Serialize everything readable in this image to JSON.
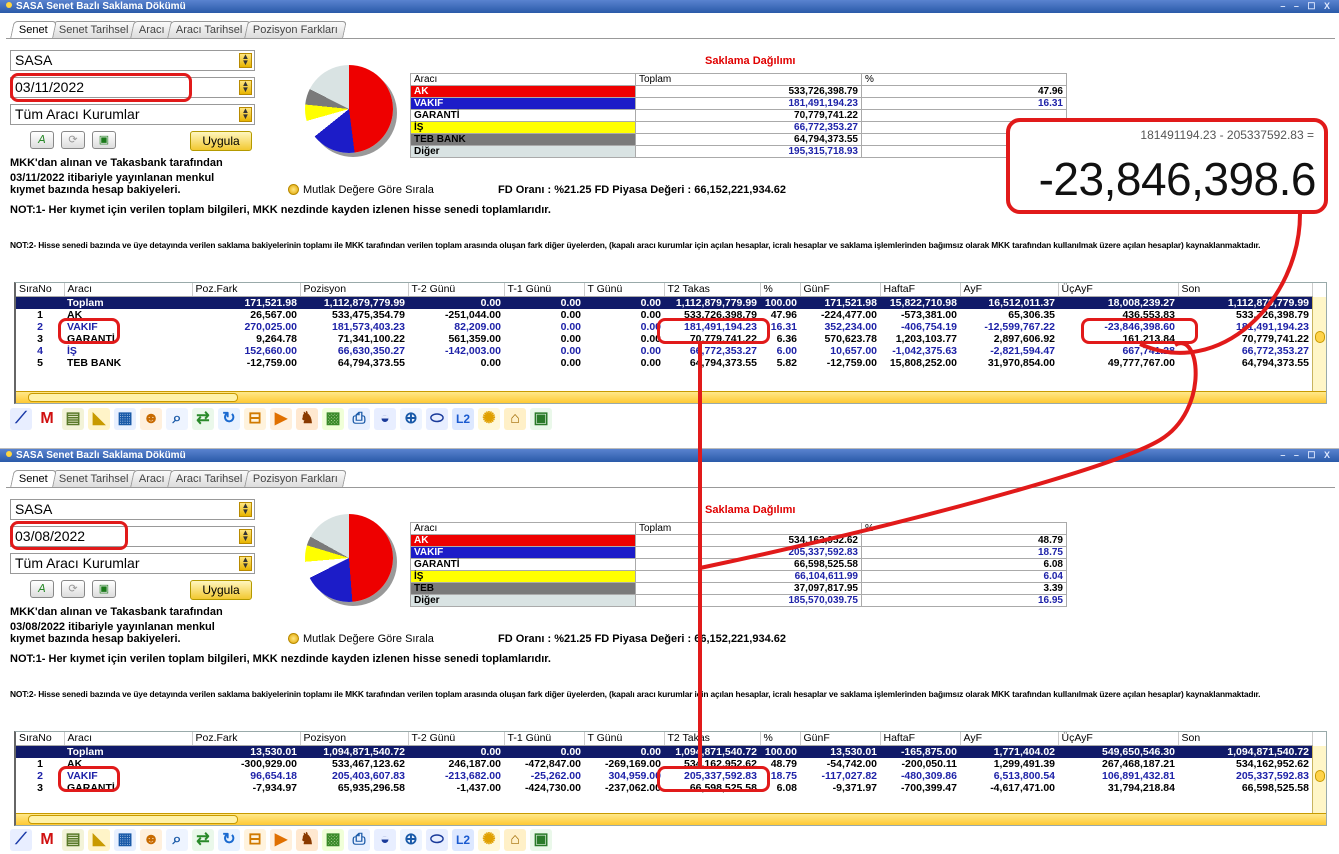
{
  "windows": [
    {
      "title": "SASA Senet Bazlı Saklama Dökümü",
      "window_controls": "– – ☐ X",
      "tabs": [
        "Senet",
        "Senet Tarihsel",
        "Aracı",
        "Aracı Tarihsel",
        "Pozisyon Farkları"
      ],
      "symbol": "SASA",
      "date": "03/11/2022",
      "broker_filter": "Tüm Aracı Kurumlar",
      "apply_label": "Uygula",
      "info_line1": "MKK'dan alınan ve Takasbank tarafından",
      "info_line2": "03/11/2022 itibariyle yayınlanan menkul",
      "info_line3": "kıymet bazında hesap bakiyeleri.",
      "sort_label": "Mutlak Değere Göre Sırala",
      "fd_text": "FD Oranı : %21.25 FD Piyasa Değeri : 66,152,221,934.62",
      "note1": "NOT:1- Her kıymet için verilen toplam bilgileri, MKK nezdinde kayden izlenen hisse senedi toplamlarıdır.",
      "note2": "NOT:2- Hisse senedi bazında ve üye detayında verilen saklama bakiyelerinin toplamı ile MKK tarafından verilen toplam arasında oluşan fark diğer üyelerden, (kapalı aracı kurumlar için açılan hesaplar, icralı hesaplar ve saklama işlemlerinden bağımsız olarak MKK tarafından kullanılmak üzere açılan hesaplar) kaynaklanmaktadır.",
      "pie_slices": [
        47.96,
        16.31,
        6.36,
        6.0,
        5.82,
        17.55
      ],
      "saklama": {
        "title": "Saklama Dağılımı",
        "headers": [
          "Aracı",
          "Toplam",
          "%"
        ],
        "rows": [
          {
            "name": "AK",
            "total": "533,726,398.79",
            "pct": "47.96",
            "color": "#ee0000"
          },
          {
            "name": "VAKIF",
            "total": "181,491,194.23",
            "pct": "16.31",
            "color": "#1c1cc8"
          },
          {
            "name": "GARANTİ",
            "total": "70,779,741.22",
            "pct": "",
            "color": "#ffffff"
          },
          {
            "name": "İŞ",
            "total": "66,772,353.27",
            "pct": "",
            "color": "#ffff00"
          },
          {
            "name": "TEB BANK",
            "total": "64,794,373.55",
            "pct": "",
            "color": "#7a7a7a"
          },
          {
            "name": "Diğer",
            "total": "195,315,718.93",
            "pct": "",
            "color": "#d9e3e3"
          }
        ]
      },
      "grid": {
        "headers": [
          "SıraNo",
          "Aracı",
          "Poz.Fark",
          "Pozisyon",
          "T-2 Günü",
          "T-1 Günü",
          "T Günü",
          "T2 Takas",
          "%",
          "GünF",
          "HaftaF",
          "AyF",
          "ÜçAyF",
          "Son"
        ],
        "rows": [
          [
            "",
            "Toplam",
            "171,521.98",
            "1,112,879,779.99",
            "0.00",
            "0.00",
            "0.00",
            "1,112,879,779.99",
            "100.00",
            "171,521.98",
            "15,822,710.98",
            "16,512,011.37",
            "18,008,239.27",
            "1,112,879,779.99"
          ],
          [
            "1",
            "AK",
            "26,567.00",
            "533,475,354.79",
            "-251,044.00",
            "0.00",
            "0.00",
            "533,726,398.79",
            "47.96",
            "-224,477.00",
            "-573,381.00",
            "65,306.35",
            "436,553.83",
            "533,726,398.79"
          ],
          [
            "2",
            "VAKIF",
            "270,025.00",
            "181,573,403.23",
            "82,209.00",
            "0.00",
            "0.00",
            "181,491,194.23",
            "16.31",
            "352,234.00",
            "-406,754.19",
            "-12,599,767.22",
            "-23,846,398.60",
            "181,491,194.23"
          ],
          [
            "3",
            "GARANTİ",
            "9,264.78",
            "71,341,100.22",
            "561,359.00",
            "0.00",
            "0.00",
            "70,779,741.22",
            "6.36",
            "570,623.78",
            "1,203,103.77",
            "2,897,606.92",
            "161,213.84",
            "70,779,741.22"
          ],
          [
            "4",
            "İŞ",
            "152,660.00",
            "66,630,350.27",
            "-142,003.00",
            "0.00",
            "0.00",
            "66,772,353.27",
            "6.00",
            "10,657.00",
            "-1,042,375.63",
            "-2,821,594.47",
            "667,741.28",
            "66,772,353.27"
          ],
          [
            "5",
            "TEB BANK",
            "-12,759.00",
            "64,794,373.55",
            "0.00",
            "0.00",
            "0.00",
            "64,794,373.55",
            "5.82",
            "-12,759.00",
            "15,808,252.00",
            "31,970,854.00",
            "49,777,767.00",
            "64,794,373.55"
          ]
        ]
      }
    },
    {
      "title": "SASA Senet Bazlı Saklama Dökümü",
      "window_controls": "– – ☐ X",
      "tabs": [
        "Senet",
        "Senet Tarihsel",
        "Aracı",
        "Aracı Tarihsel",
        "Pozisyon Farkları"
      ],
      "symbol": "SASA",
      "date": "03/08/2022",
      "broker_filter": "Tüm Aracı Kurumlar",
      "apply_label": "Uygula",
      "info_line1": "MKK'dan alınan ve Takasbank tarafından",
      "info_line2": "03/08/2022 itibariyle yayınlanan menkul",
      "info_line3": "kıymet bazında hesap bakiyeleri.",
      "sort_label": "Mutlak Değere Göre Sırala",
      "fd_text": "FD Oranı : %21.25 FD Piyasa Değeri : 66,152,221,934.62",
      "note1": "NOT:1- Her kıymet için verilen toplam bilgileri, MKK nezdinde kayden izlenen hisse senedi toplamlarıdır.",
      "note2": "NOT:2- Hisse senedi bazında ve üye detayında verilen saklama bakiyelerinin toplamı ile MKK tarafından verilen toplam arasında oluşan fark diğer üyelerden, (kapalı aracı kurumlar için açılan hesaplar, icralı hesaplar ve saklama işlemlerinden bağımsız olarak MKK tarafından kullanılmak üzere açılan hesaplar) kaynaklanmaktadır.",
      "pie_slices": [
        48.79,
        18.75,
        6.08,
        6.04,
        3.39,
        16.95
      ],
      "saklama": {
        "title": "Saklama Dağılımı",
        "headers": [
          "Aracı",
          "Toplam",
          "%"
        ],
        "rows": [
          {
            "name": "AK",
            "total": "534,162,952.62",
            "pct": "48.79",
            "color": "#ee0000"
          },
          {
            "name": "VAKIF",
            "total": "205,337,592.83",
            "pct": "18.75",
            "color": "#1c1cc8"
          },
          {
            "name": "GARANTİ",
            "total": "66,598,525.58",
            "pct": "6.08",
            "color": "#ffffff"
          },
          {
            "name": "İŞ",
            "total": "66,104,611.99",
            "pct": "6.04",
            "color": "#ffff00"
          },
          {
            "name": "TEB",
            "total": "37,097,817.95",
            "pct": "3.39",
            "color": "#7a7a7a"
          },
          {
            "name": "Diğer",
            "total": "185,570,039.75",
            "pct": "16.95",
            "color": "#d9e3e3"
          }
        ]
      },
      "grid": {
        "headers": [
          "SıraNo",
          "Aracı",
          "Poz.Fark",
          "Pozisyon",
          "T-2 Günü",
          "T-1 Günü",
          "T Günü",
          "T2 Takas",
          "%",
          "GünF",
          "HaftaF",
          "AyF",
          "ÜçAyF",
          "Son"
        ],
        "rows": [
          [
            "",
            "Toplam",
            "13,530.01",
            "1,094,871,540.72",
            "0.00",
            "0.00",
            "0.00",
            "1,094,871,540.72",
            "100.00",
            "13,530.01",
            "-165,875.00",
            "1,771,404.02",
            "549,650,546.30",
            "1,094,871,540.72"
          ],
          [
            "1",
            "AK",
            "-300,929.00",
            "533,467,123.62",
            "246,187.00",
            "-472,847.00",
            "-269,169.00",
            "534,162,952.62",
            "48.79",
            "-54,742.00",
            "-200,050.11",
            "1,299,491.39",
            "267,468,187.21",
            "534,162,952.62"
          ],
          [
            "2",
            "VAKIF",
            "96,654.18",
            "205,403,607.83",
            "-213,682.00",
            "-25,262.00",
            "304,959.00",
            "205,337,592.83",
            "18.75",
            "-117,027.82",
            "-480,309.86",
            "6,513,800.54",
            "106,891,432.81",
            "205,337,592.83"
          ],
          [
            "3",
            "GARANTİ",
            "-7,934.97",
            "65,935,296.58",
            "-1,437.00",
            "-424,730.00",
            "-237,062.00",
            "66,598,525.58",
            "6.08",
            "-9,371.97",
            "-700,399.47",
            "-4,617,471.00",
            "31,794,218.84",
            "66,598,525.58"
          ]
        ]
      }
    }
  ],
  "annotation": {
    "calc": "181491194.23 - 205337592.83 =",
    "result": "-23,846,398.6",
    "color": "#e11a1a"
  },
  "toolbar_icons": [
    "line-chart-icon",
    "m-logo-icon",
    "document-icon",
    "area-chart-icon",
    "table-icon",
    "people-icon",
    "magnifier-icon",
    "swap-icon",
    "refresh-icon",
    "split-icon",
    "play-icon",
    "bull-icon",
    "heatmap-icon",
    "print-icon",
    "database-icon",
    "zoom-icon",
    "cylinder-icon",
    "l2-icon",
    "sun-icon",
    "bank-icon",
    "chart-box-icon"
  ]
}
